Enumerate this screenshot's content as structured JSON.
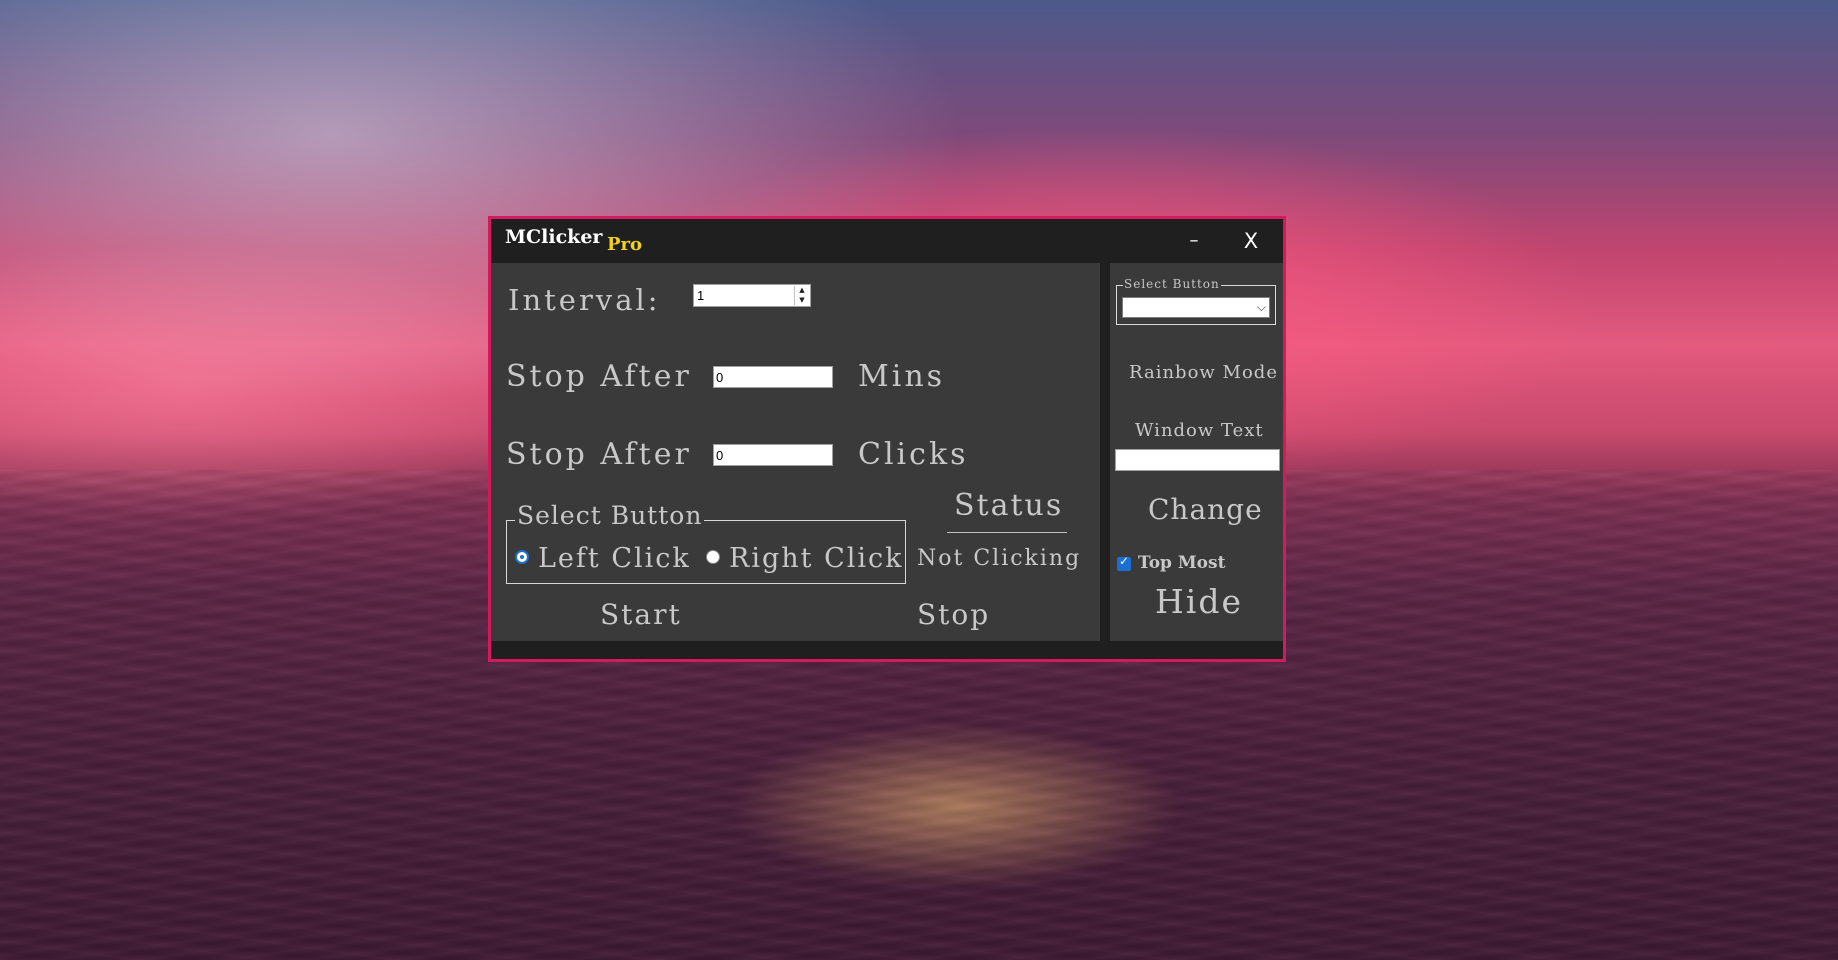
{
  "window": {
    "title": "MClicker",
    "edition": "Pro",
    "minimize_label": "–",
    "close_label": "X",
    "border_color": "#d21a5c"
  },
  "main": {
    "interval_label": "Interval:",
    "interval_value": "1",
    "stop_after_label_1": "Stop After",
    "stop_after_mins_value": "0",
    "mins_label": "Mins",
    "stop_after_label_2": "Stop After",
    "stop_after_clicks_value": "0",
    "clicks_label": "Clicks",
    "select_button_legend": "Select Button",
    "left_click_label": "Left Click",
    "right_click_label": "Right Click",
    "selected_click": "Left Click",
    "status_title": "Status",
    "status_value": "Not Clicking",
    "start_label": "Start",
    "stop_label": "Stop"
  },
  "side": {
    "select_button_legend": "Select Button",
    "select_button_value": "",
    "rainbow_mode_label": "Rainbow Mode",
    "window_text_label": "Window Text",
    "window_text_value": "",
    "change_label": "Change",
    "top_most_label": "Top Most",
    "top_most_checked": true,
    "hide_label": "Hide"
  },
  "icons": {
    "spin_up": "▲",
    "spin_down": "▼",
    "combo_arrow": "⌵",
    "check": "✓"
  },
  "colors": {
    "accent": "#1a6fd0",
    "edition": "#f3d21c",
    "panel": "#3a3a3a",
    "titlebar": "#1f1f1f"
  }
}
